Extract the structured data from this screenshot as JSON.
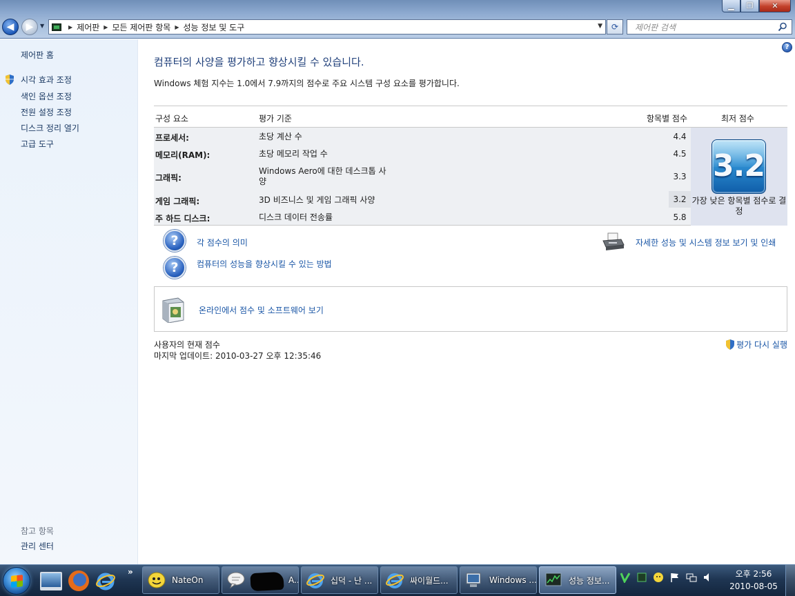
{
  "window": {
    "breadcrumb": [
      "제어판",
      "모든 제어판 항목",
      "성능 정보 및 도구"
    ],
    "search_placeholder": "제어판 검색"
  },
  "sidebar": {
    "home": "제어판 홈",
    "links": [
      "시각 효과 조정",
      "색인 옵션 조정",
      "전원 설정 조정",
      "디스크 정리 열기",
      "고급 도구"
    ],
    "see_also_label": "참고 항목",
    "see_also_links": [
      "관리 센터"
    ]
  },
  "main": {
    "heading": "컴퓨터의 사양을 평가하고 향상시킬 수 있습니다.",
    "subtitle": "Windows 체험 지수는 1.0에서 7.9까지의 점수로 주요 시스템 구성 요소를 평가합니다.",
    "table": {
      "headers": {
        "component": "구성 요소",
        "rating": "평가 기준",
        "subscore": "항목별 점수",
        "basescore": "최저 점수"
      },
      "rows": [
        {
          "component": "프로세서:",
          "criteria": "초당 계산 수",
          "score": "4.4"
        },
        {
          "component": "메모리(RAM):",
          "criteria": "초당 메모리 작업 수",
          "score": "4.5"
        },
        {
          "component": "그래픽:",
          "criteria": "Windows Aero에 대한 데스크톱 사양",
          "score": "3.3"
        },
        {
          "component": "게임 그래픽:",
          "criteria": "3D 비즈니스 및 게임 그래픽 사양",
          "score": "3.2"
        },
        {
          "component": "주 하드 디스크:",
          "criteria": "디스크 데이터 전송률",
          "score": "5.8"
        }
      ],
      "base_score": "3.2",
      "base_caption": "가장 낮은 항목별 점수로 결정"
    },
    "links": {
      "meaning": "각 점수의 의미",
      "improve": "컴퓨터의 성능을 향상시킬 수 있는 방법",
      "details": "자세한 성능 및 시스템 정보 보기 및 인쇄",
      "online": "온라인에서 점수 및 소프트웨어 보기",
      "rerun": "평가 다시 실행"
    },
    "footer": {
      "current_label": "사용자의 현재 점수",
      "last_update": "마지막 업데이트: 2010-03-27 오후 12:35:46"
    }
  },
  "taskbar": {
    "more": "»",
    "tasks": [
      {
        "label": "NateOn",
        "icon": "nateon-icon"
      },
      {
        "label": "A...",
        "icon": "chat-icon"
      },
      {
        "label": "십덕 - 난 ...",
        "icon": "ie-icon"
      },
      {
        "label": "싸이월드...",
        "icon": "ie-icon"
      },
      {
        "label": "Windows ...",
        "icon": "computer-icon"
      },
      {
        "label": "성능 정보...",
        "icon": "performance-icon"
      }
    ],
    "clock_time": "오후 2:56",
    "clock_date": "2010-08-05"
  },
  "colors": {
    "link": "#1a56a6",
    "heading": "#1f3f7a",
    "badge": "#2e8fd3"
  }
}
